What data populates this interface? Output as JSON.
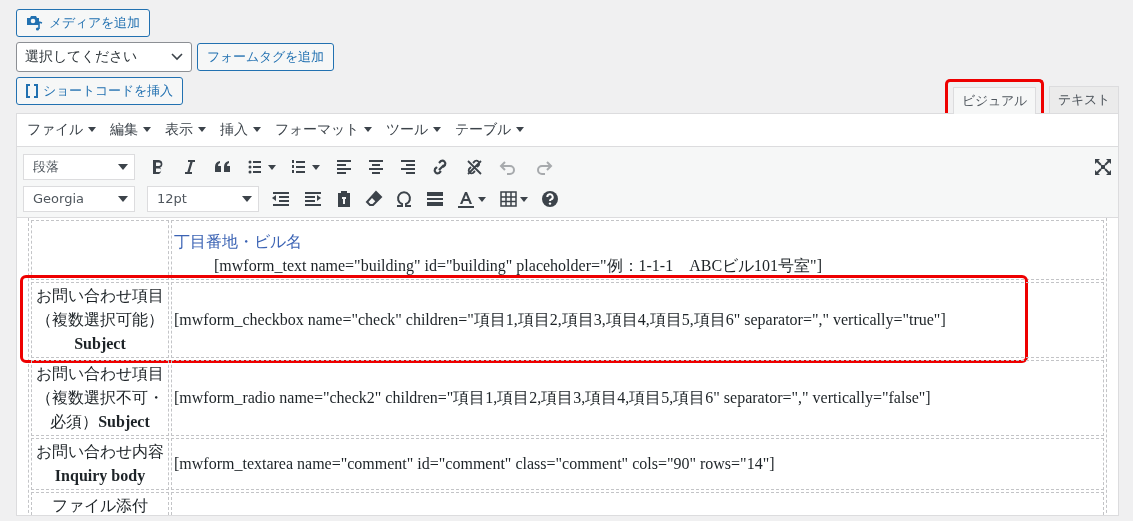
{
  "media_button": {
    "label": "メディアを追加"
  },
  "form_select": {
    "value": "選択してください"
  },
  "form_tag_button": {
    "label": "フォームタグを追加"
  },
  "shortcode_button": {
    "label": "ショートコードを挿入"
  },
  "editor_tabs": [
    {
      "label": "ビジュアル",
      "selected": true,
      "highlighted": true
    },
    {
      "label": "テキスト",
      "selected": false,
      "highlighted": false
    }
  ],
  "menu_bar": [
    "ファイル",
    "編集",
    "表示",
    "挿入",
    "フォーマット",
    "ツール",
    "テーブル"
  ],
  "toolbar": {
    "format_select": "段落",
    "font_select": "Georgia",
    "size_select": "12pt"
  },
  "table": {
    "rows": [
      {
        "label": "",
        "highlighted": false,
        "lines": [
          {
            "kind": "caption",
            "text": "丁目番地・ビル名"
          },
          {
            "kind": "indented",
            "text": "[mwform_text name=\"building\" id=\"building\" placeholder=\"例：1-1-1　ABCビル101号室\"]"
          }
        ]
      },
      {
        "label": "お問い合わせ項目（複数選択可能）**Subject**",
        "highlighted": true,
        "lines": [
          {
            "kind": "code",
            "text": "[mwform_checkbox name=\"check\" children=\"項目1,項目2,項目3,項目4,項目5,項目6\" separator=\",\" vertically=\"true\"]"
          }
        ]
      },
      {
        "label": "お問い合わせ項目（複数選択不可・必須）**Subject**",
        "highlighted": false,
        "lines": [
          {
            "kind": "code",
            "text": "[mwform_radio name=\"check2\" children=\"項目1,項目2,項目3,項目4,項目5,項目6\" separator=\",\" vertically=\"false\"]"
          }
        ]
      },
      {
        "label": "お問い合わせ内容**Inquiry body**",
        "highlighted": false,
        "lines": [
          {
            "kind": "code",
            "text": "[mwform_textarea name=\"comment\" id=\"comment\" class=\"comment\" cols=\"90\" rows=\"14\"]"
          }
        ]
      },
      {
        "label": "ファイル添付",
        "highlighted": false,
        "lines": []
      }
    ]
  }
}
